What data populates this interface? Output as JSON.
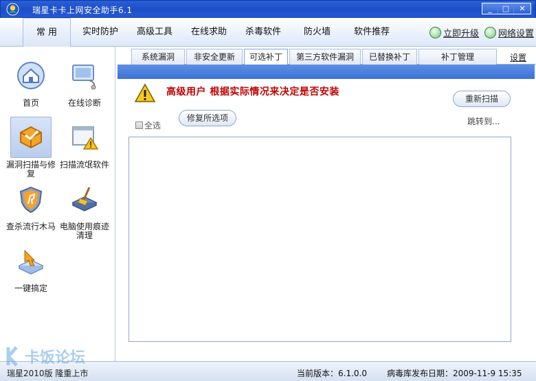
{
  "window": {
    "title": "瑞星卡卡上网安全助手6.1",
    "minimize_glyph": "_",
    "maximize_glyph": "□",
    "close_glyph": "✕"
  },
  "menu": {
    "items": [
      "常 用",
      "实时防护",
      "高级工具",
      "在线求助",
      "杀毒软件",
      "防火墙",
      "软件推荐"
    ],
    "upgrade": "立即升级",
    "network_settings": "网络设置"
  },
  "sidebar": {
    "items": [
      {
        "label": "首页",
        "icon": "house-icon"
      },
      {
        "label": "在线诊断",
        "icon": "monitor-stethoscope-icon"
      },
      {
        "label": "漏洞扫描与修复",
        "icon": "shield-box-icon"
      },
      {
        "label": "扫描流氓软件",
        "icon": "window-warning-icon"
      },
      {
        "label": "查杀流行木马",
        "icon": "shield-horse-icon"
      },
      {
        "label": "电脑使用痕迹清理",
        "icon": "broom-disk-icon"
      },
      {
        "label": "一键搞定",
        "icon": "press-button-icon"
      }
    ]
  },
  "subtabs": {
    "items": [
      "系统漏洞",
      "非安全更新",
      "可选补丁",
      "第三方软件漏洞",
      "已替换补丁",
      "补丁管理"
    ],
    "active_index": 2,
    "settings": "设置"
  },
  "panel": {
    "warning": "高级用户  根据实际情况来决定是否安装",
    "rescan": "重新扫描",
    "select_all": "全选",
    "fix_selected": "修复所选项",
    "jump_to": "跳转到..."
  },
  "statusbar": {
    "left": "瑞星2010版 隆重上市",
    "version": "当前版本：6.1.0.0",
    "virus_db_date": "病毒库发布日期：2009-11-9 15:35"
  },
  "watermark": {
    "text": "卡饭论坛"
  }
}
